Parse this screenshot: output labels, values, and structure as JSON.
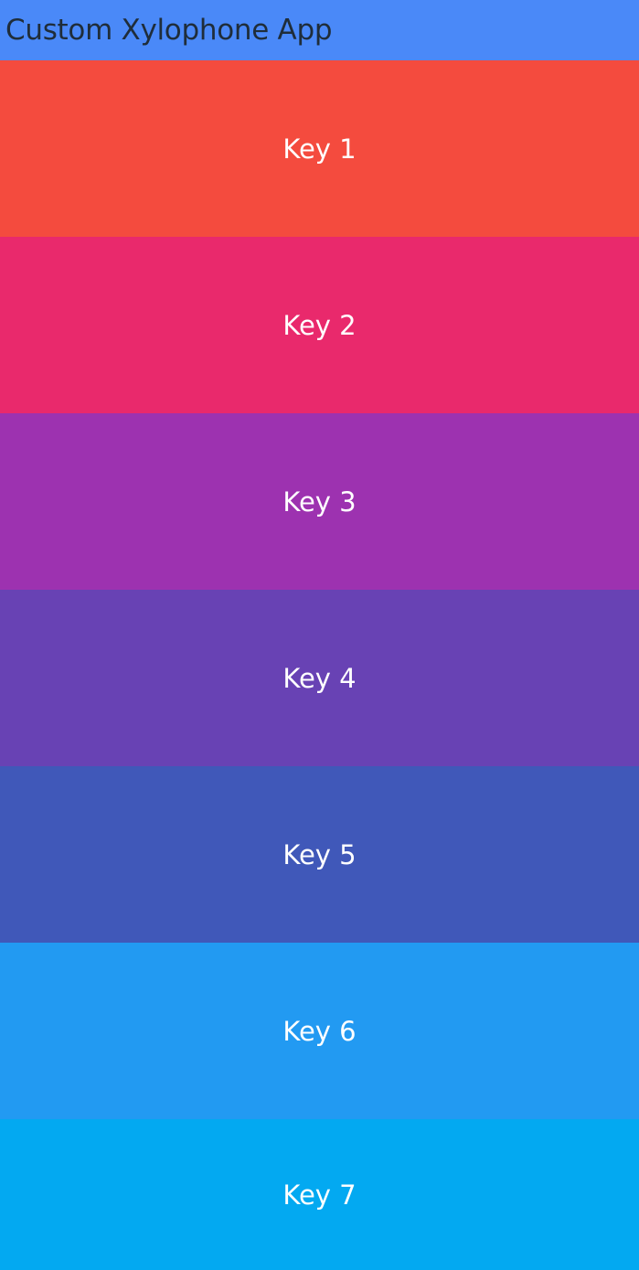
{
  "app_bar": {
    "title": "Custom Xylophone App",
    "color": "#4a89f8"
  },
  "keys": [
    {
      "label": "Key 1",
      "color": "#f44b3e"
    },
    {
      "label": "Key 2",
      "color": "#e9296c"
    },
    {
      "label": "Key 3",
      "color": "#9d32b0"
    },
    {
      "label": "Key 4",
      "color": "#6842b4"
    },
    {
      "label": "Key 5",
      "color": "#4058b9"
    },
    {
      "label": "Key 6",
      "color": "#229af2"
    },
    {
      "label": "Key 7",
      "color": "#03a9f1"
    }
  ]
}
